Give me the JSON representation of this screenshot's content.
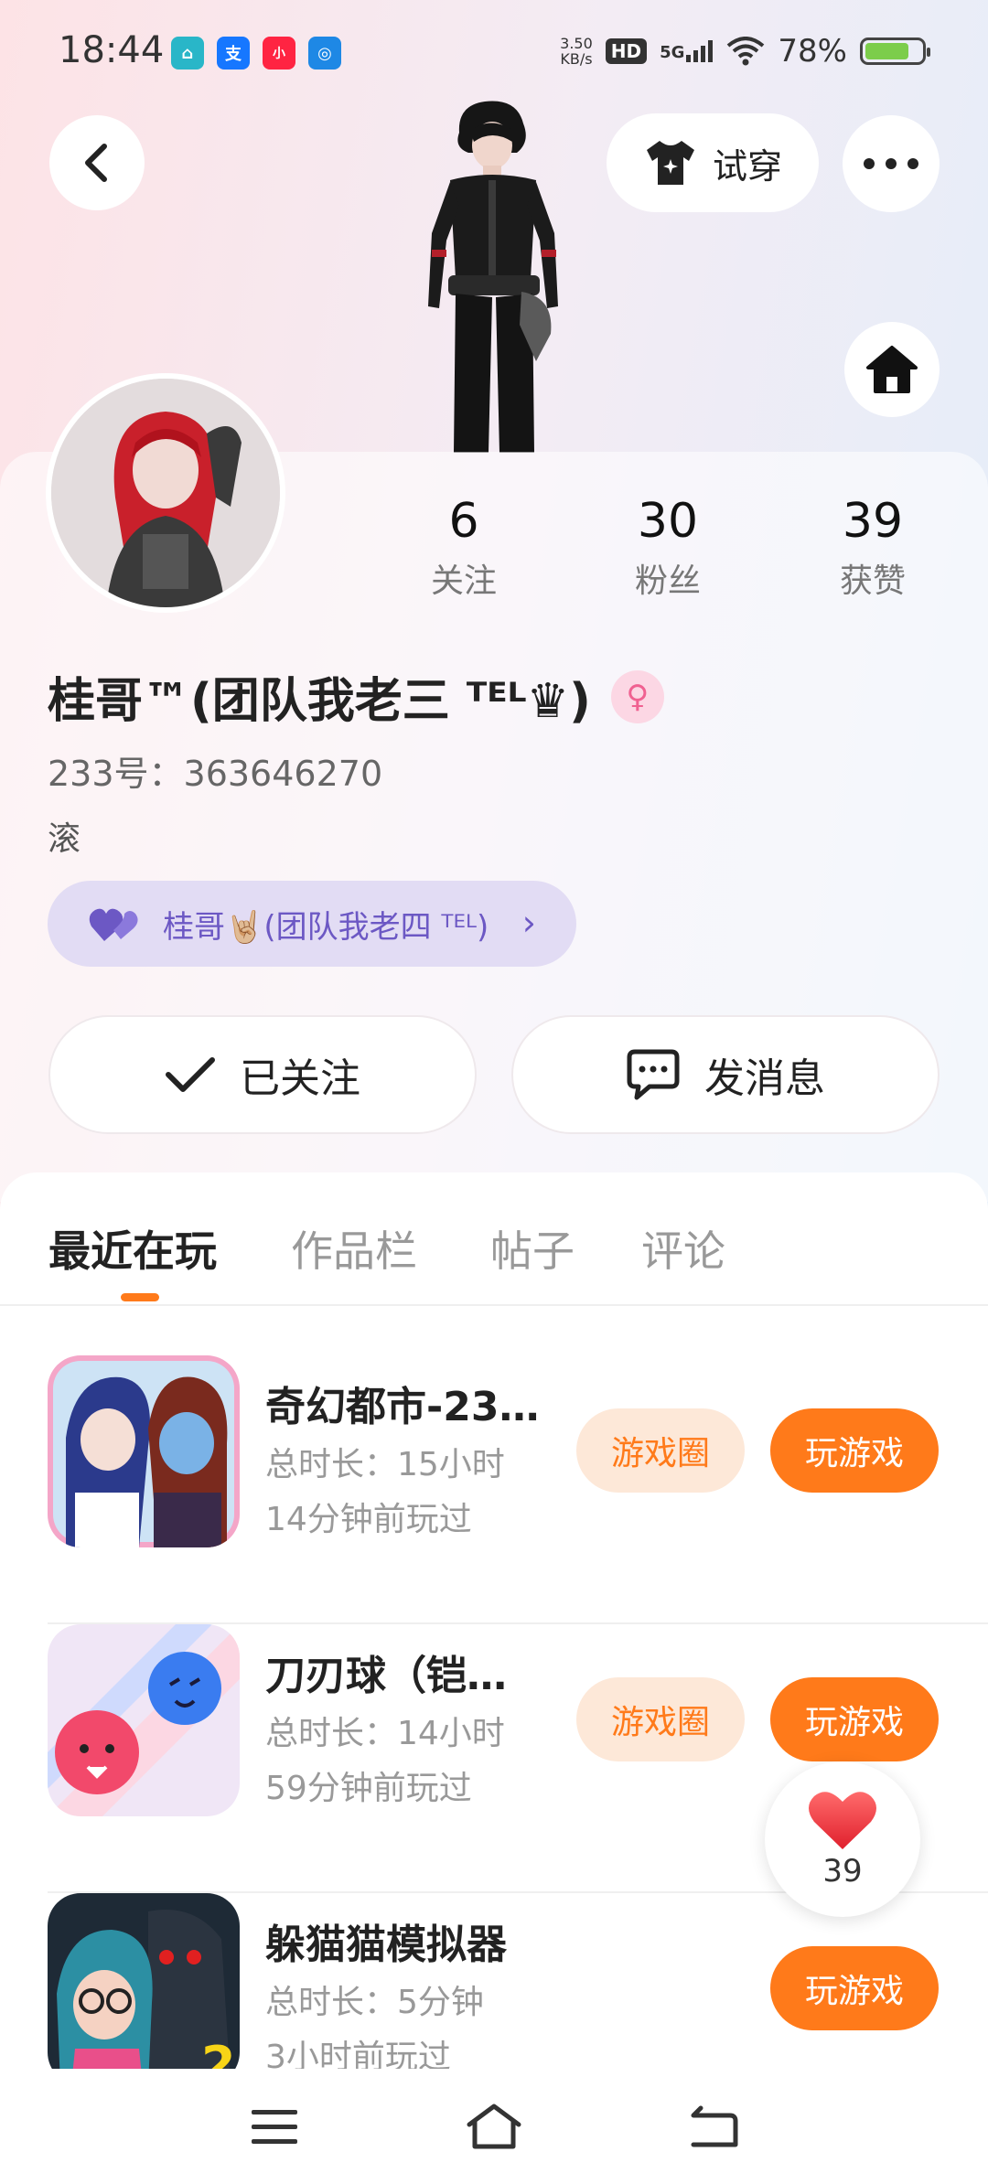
{
  "status_bar": {
    "time": "18:44",
    "net_speed_value": "3.50",
    "net_speed_unit": "KB/s",
    "hd": "HD",
    "network": "5G",
    "battery_percent": "78%",
    "battery_level": 0.78,
    "app_icons": [
      {
        "name": "app-home-icon",
        "color": "#29b6c8",
        "glyph": "⌂"
      },
      {
        "name": "alipay-icon",
        "color": "#1677ff",
        "glyph": "支"
      },
      {
        "name": "xiaohongshu-icon",
        "color": "#ff2442",
        "glyph": "小"
      },
      {
        "name": "app-blue-icon",
        "color": "#1e88e5",
        "glyph": "◎"
      }
    ]
  },
  "header": {
    "try_on_label": "试穿"
  },
  "profile": {
    "stats": [
      {
        "value": "6",
        "label": "关注"
      },
      {
        "value": "30",
        "label": "粉丝"
      },
      {
        "value": "39",
        "label": "获赞"
      }
    ],
    "nickname": "桂哥™(团队我老三 ᵀᴱᴸ♛)",
    "gender_symbol": "♀",
    "uid": "233号：363646270",
    "bio": "滚",
    "team_label": "桂哥🤘🏼(团队我老四 ᵀᴱᴸ)",
    "follow_label": "已关注",
    "message_label": "发消息"
  },
  "tabs": [
    "最近在玩",
    "作品栏",
    "帖子",
    "评论"
  ],
  "games": [
    {
      "title": "奇幻都市-23…",
      "duration": "总时长：15小时",
      "last_played": "14分钟前玩过",
      "circle_label": "游戏圈",
      "play_label": "玩游戏"
    },
    {
      "title": "刀刃球（铠…",
      "duration": "总时长：14小时",
      "last_played": "59分钟前玩过",
      "circle_label": "游戏圈",
      "play_label": "玩游戏"
    },
    {
      "title": "躲猫猫模拟器",
      "duration": "总时长：5分钟",
      "last_played": "3小时前玩过",
      "play_label": "玩游戏"
    }
  ],
  "like_float": {
    "count": "39"
  },
  "colors": {
    "accent": "#ff7a1a",
    "accent_soft": "#fde8d8",
    "team_purple": "#6c58c4"
  }
}
